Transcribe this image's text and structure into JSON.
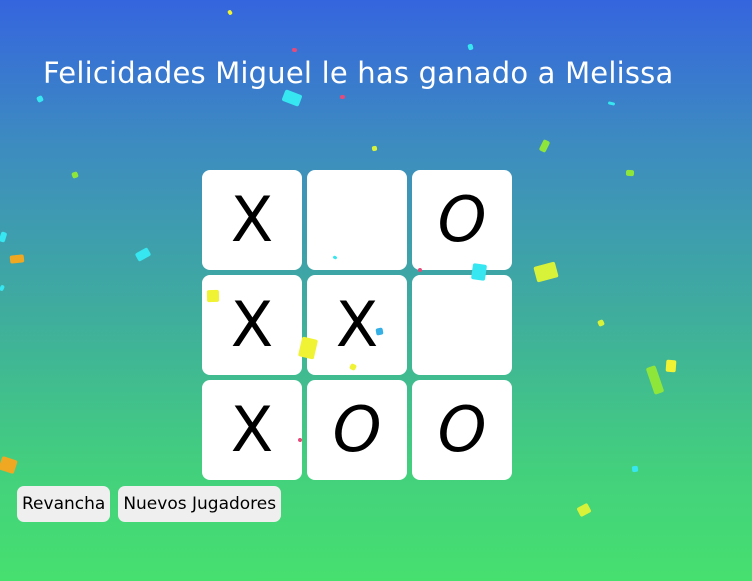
{
  "message": "Felicidades Miguel le has ganado a Melissa",
  "board": [
    [
      "X",
      "",
      "O"
    ],
    [
      "X",
      "X",
      ""
    ],
    [
      "X",
      "O",
      "O"
    ]
  ],
  "buttons": {
    "rematch_label": "Revancha",
    "new_players_label": "Nuevos Jugadores"
  },
  "colors": {
    "background_top": "#3565de",
    "background_bottom": "#46e06f",
    "confetti": [
      "#f0f234",
      "#d8f23a",
      "#36e6f0",
      "#f0a822",
      "#8fe63a",
      "#c43cd8",
      "#e64a7a",
      "#34b0e6"
    ]
  }
}
